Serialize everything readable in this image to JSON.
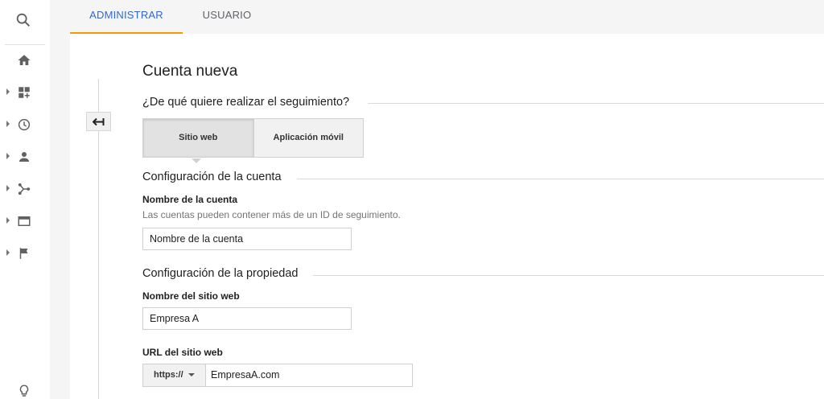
{
  "tabs": [
    {
      "label": "ADMINISTRAR",
      "active": true
    },
    {
      "label": "USUARIO",
      "active": false
    }
  ],
  "nav": {
    "icons": [
      "search-icon",
      "home-icon",
      "dashboard-icon",
      "clock-icon",
      "person-icon",
      "acquisition-icon",
      "behavior-icon",
      "flag-icon",
      "lightbulb-icon"
    ]
  },
  "page": {
    "title": "Cuenta nueva",
    "tracking_question": "¿De qué quiere realizar el seguimiento?",
    "tracking_options": [
      "Sitio web",
      "Aplicación móvil"
    ],
    "tracking_selected": "Sitio web",
    "account_section": "Configuración de la cuenta",
    "account_name_label": "Nombre de la cuenta",
    "account_name_hint": "Las cuentas pueden contener más de un ID de seguimiento.",
    "account_name_value": "Nombre de la cuenta",
    "property_section": "Configuración de la propiedad",
    "site_name_label": "Nombre del sitio web",
    "site_name_value": "Empresa A",
    "site_url_label": "URL del sitio web",
    "url_protocol": "https://",
    "url_value": "EmpresaA.com"
  },
  "colors": {
    "accent_tab": "#3367d6",
    "tab_underline": "#f29900"
  }
}
